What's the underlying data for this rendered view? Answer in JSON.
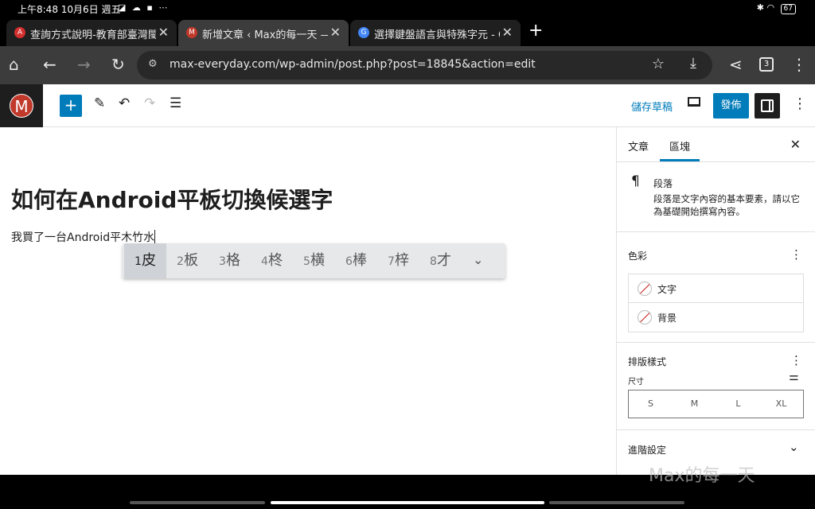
{
  "status": {
    "time": "上午8:48 10月6日 週五",
    "battery": "67",
    "notif_icons": "◪ ☁ ▪ ⋯"
  },
  "tabs": [
    {
      "title": "查詢方式說明-教育部臺灣閩南語",
      "favicon_color": "#d32f2f",
      "favicon_text": "A"
    },
    {
      "title": "新增文章 ‹ Max的每一天 — WordPress",
      "favicon_color": "#c0392b",
      "favicon_text": "M"
    },
    {
      "title": "選擇鍵盤語言與特殊字元 - Chrome",
      "favicon_color": "#4285f4",
      "favicon_text": "G"
    }
  ],
  "address": {
    "url": "max-everyday.com/wp-admin/post.php?post=18845&action=edit",
    "tab_count": "3"
  },
  "wp": {
    "logo_letter": "M",
    "save_draft": "儲存草稿",
    "publish": "發佈",
    "post_title": "如何在Android平板切換候選字",
    "paragraph": "我買了一台Android平木竹水"
  },
  "ime": {
    "candidates": [
      {
        "n": "1",
        "c": "皮"
      },
      {
        "n": "2",
        "c": "板"
      },
      {
        "n": "3",
        "c": "格"
      },
      {
        "n": "4",
        "c": "柊"
      },
      {
        "n": "5",
        "c": "横"
      },
      {
        "n": "6",
        "c": "棒"
      },
      {
        "n": "7",
        "c": "梓"
      },
      {
        "n": "8",
        "c": "才"
      }
    ]
  },
  "sidebar": {
    "tab_post": "文章",
    "tab_block": "區塊",
    "block_name": "段落",
    "block_desc": "段落是文字內容的基本要素，請以它為基礎開始撰寫內容。",
    "color_title": "色彩",
    "color_text": "文字",
    "color_bg": "背景",
    "typo_title": "排版樣式",
    "size_label": "尺寸",
    "sizes": [
      "S",
      "M",
      "L",
      "XL"
    ],
    "advanced": "進階設定"
  },
  "watermark": "Max的每一天"
}
